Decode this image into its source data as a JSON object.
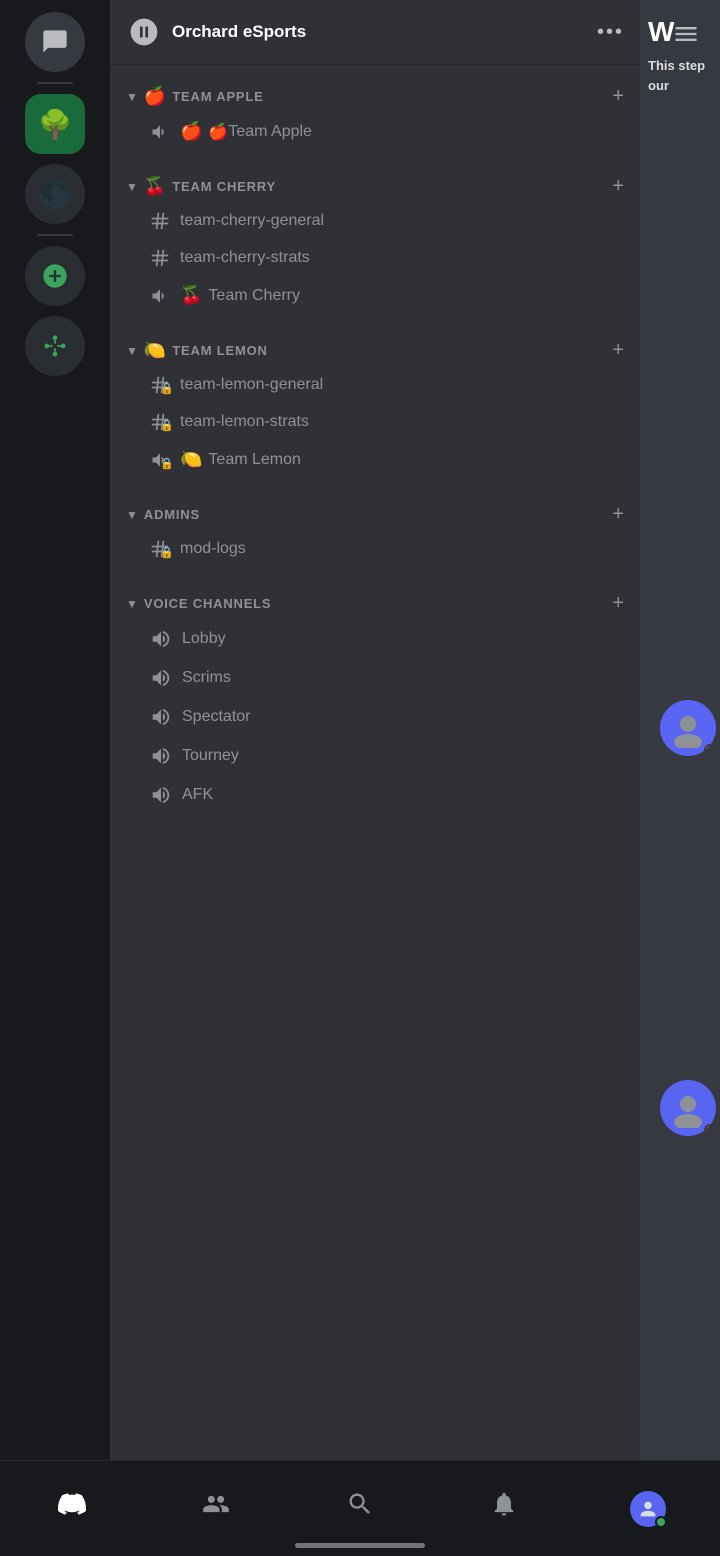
{
  "server": {
    "name": "Orchard eSports",
    "dots": "•••"
  },
  "sidebar": {
    "icons": [
      {
        "name": "chat",
        "label": "Chat"
      },
      {
        "name": "orchard",
        "label": "Orchard"
      },
      {
        "name": "dark-server",
        "label": "Dark Server"
      },
      {
        "name": "add-server",
        "label": "Add Server"
      },
      {
        "name": "discover",
        "label": "Discover"
      }
    ]
  },
  "categories": [
    {
      "id": "team-apple",
      "emoji": "🍎",
      "name": "TEAM APPLE",
      "channels": [
        {
          "type": "text",
          "name": "Team Apple",
          "locked": false,
          "voice": false,
          "emoji": "🍎",
          "isVoice": false,
          "isEmojiName": true
        }
      ]
    },
    {
      "id": "team-cherry",
      "emoji": "🍒",
      "name": "TEAM CHERRY",
      "channels": [
        {
          "type": "text",
          "name": "team-cherry-general",
          "locked": false,
          "voice": false,
          "isVoice": false,
          "isEmojiName": false
        },
        {
          "type": "text",
          "name": "team-cherry-strats",
          "locked": false,
          "voice": false,
          "isVoice": false,
          "isEmojiName": false
        },
        {
          "type": "voice",
          "name": "Team Cherry",
          "locked": false,
          "voice": true,
          "isVoice": true,
          "isEmojiName": false,
          "emoji": "🍒"
        }
      ]
    },
    {
      "id": "team-lemon",
      "emoji": "🍋",
      "name": "TEAM LEMON",
      "channels": [
        {
          "type": "text",
          "name": "team-lemon-general",
          "locked": true,
          "voice": false,
          "isVoice": false,
          "isEmojiName": false
        },
        {
          "type": "text",
          "name": "team-lemon-strats",
          "locked": true,
          "voice": false,
          "isVoice": false,
          "isEmojiName": false
        },
        {
          "type": "voice",
          "name": "Team Lemon",
          "locked": false,
          "voice": true,
          "isVoice": true,
          "isEmojiName": false,
          "emoji": "🍋"
        }
      ]
    },
    {
      "id": "admins",
      "emoji": "",
      "name": "ADMINS",
      "channels": [
        {
          "type": "text",
          "name": "mod-logs",
          "locked": true,
          "voice": false,
          "isVoice": false,
          "isEmojiName": false
        }
      ]
    },
    {
      "id": "voice-channels",
      "emoji": "",
      "name": "VOICE CHANNELS",
      "channels": [
        {
          "type": "voice",
          "name": "Lobby",
          "locked": false,
          "isVoice": true,
          "isEmojiName": false
        },
        {
          "type": "voice",
          "name": "Scrims",
          "locked": false,
          "isVoice": true,
          "isEmojiName": false
        },
        {
          "type": "voice",
          "name": "Spectator",
          "locked": false,
          "isVoice": true,
          "isEmojiName": false
        },
        {
          "type": "voice",
          "name": "Tourney",
          "locked": false,
          "isVoice": true,
          "isEmojiName": false
        },
        {
          "type": "voice",
          "name": "AFK",
          "locked": false,
          "isVoice": true,
          "isEmojiName": false
        }
      ]
    }
  ],
  "right_panel": {
    "letter": "W",
    "preview_text": "This step our"
  },
  "bottom_nav": {
    "items": [
      {
        "name": "home",
        "label": "Home",
        "active": true
      },
      {
        "name": "friends",
        "label": "Friends"
      },
      {
        "name": "search",
        "label": "Search"
      },
      {
        "name": "notifications",
        "label": "Notifications"
      },
      {
        "name": "profile",
        "label": "Profile"
      }
    ]
  }
}
